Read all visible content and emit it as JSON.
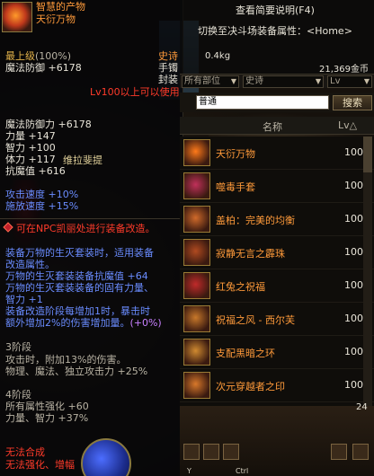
{
  "background": {
    "npc_label": "维拉斐提"
  },
  "tooltip": {
    "rarity_label": "智慧的产物",
    "item_name": "天衍万物",
    "grade_label": "最上级",
    "grade_percent": "(100%)",
    "magic_defense": "魔法防御 +6178",
    "type_epic": "史诗",
    "type_slot": "手镯",
    "type_sealed": "封装",
    "level_req": "Lv100以上可以使用",
    "stats": [
      "魔法防御力 +6178",
      "力量 +147",
      "智力 +100",
      "体力 +117",
      "抗魔值 +616"
    ],
    "speed": [
      "攻击速度 +10%",
      "施放速度 +15%"
    ],
    "npc_note": "可在NPC凯丽处进行装备改造。",
    "desc": [
      "装备万物的生灭套装时，适用装备",
      "改造属性。",
      "万物的生灭套装装备抗魔值 +64",
      "万物的生灭套装装备的固有力量、",
      "智力 +1",
      "装备改造阶段每增加1时，暴击时",
      "额外增加2%的伤害增加量。"
    ],
    "desc_suffix": "(+0%)",
    "stage3_title": "3阶段",
    "stage3_lines": [
      "攻击时，附加13%的伤害。",
      "物理、魔法、独立攻击力 +25%"
    ],
    "stage4_title": "4阶段",
    "stage4_lines": [
      "所有属性强化 +60",
      "力量、智力 +37%"
    ],
    "footer": [
      "无法合成",
      "无法强化、增幅"
    ]
  },
  "equip": {
    "help_label": "查看简要说明(F4)",
    "switch_label": "切换至决斗场装备属性：",
    "switch_home": "<Home>",
    "weight": "0.4kg",
    "gold": "21,369金币",
    "filter_part": "所有部位",
    "filter_rarity": "史诗",
    "filter_lv": "Lv",
    "search_value": "普通",
    "search_button": "搜索",
    "header_name": "名称",
    "header_lv": "Lv",
    "header_lv_sort": "△",
    "items": [
      {
        "name": "天衍万物",
        "lv": "100",
        "icon_color": "#ff7a1a"
      },
      {
        "name": "噬毒手套",
        "lv": "100",
        "icon_color": "#c0305a"
      },
      {
        "name": "盖柏：完美的均衡",
        "lv": "100",
        "icon_color": "#d06a2a"
      },
      {
        "name": "寂静无言之霹珠",
        "lv": "100",
        "icon_color": "#b04a20"
      },
      {
        "name": "红兔之祝福",
        "lv": "100",
        "icon_color": "#c02a2a"
      },
      {
        "name": "祝福之风 - 西尔芙",
        "lv": "100",
        "icon_color": "#c8782a"
      },
      {
        "name": "支配黑暗之环",
        "lv": "100",
        "icon_color": "#d08a30"
      },
      {
        "name": "次元穿越者之印",
        "lv": "100",
        "icon_color": "#d8782a"
      }
    ]
  },
  "hud": {
    "keys": [
      "Y",
      "Ctrl"
    ],
    "count": "24"
  },
  "colors": {
    "rarity_orange": "#ff9a3a",
    "stat_blue": "#6a8cff",
    "warning_red": "#ff3b2a",
    "gold": "#e4b34a"
  }
}
